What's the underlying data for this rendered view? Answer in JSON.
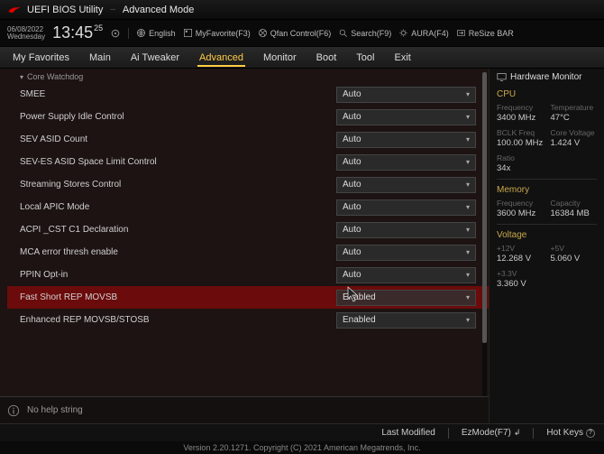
{
  "title_app": "UEFI BIOS Utility",
  "title_mode": "Advanced Mode",
  "date": "06/08/2022",
  "day": "Wednesday",
  "time_main": "13:45",
  "time_sec": "25",
  "toolbar": {
    "lang": "English",
    "fav": "MyFavorite(F3)",
    "qfan": "Qfan Control(F6)",
    "search": "Search(F9)",
    "aura": "AURA(F4)",
    "rebar": "ReSize BAR"
  },
  "menu": [
    "My Favorites",
    "Main",
    "Ai Tweaker",
    "Advanced",
    "Monitor",
    "Boot",
    "Tool",
    "Exit"
  ],
  "menu_active": "Advanced",
  "section": "Core Watchdog",
  "rows": [
    {
      "label": "SMEE",
      "value": "Auto",
      "sel": false
    },
    {
      "label": "Power Supply Idle Control",
      "value": "Auto",
      "sel": false
    },
    {
      "label": "SEV ASID Count",
      "value": "Auto",
      "sel": false
    },
    {
      "label": "SEV-ES ASID Space Limit Control",
      "value": "Auto",
      "sel": false
    },
    {
      "label": "Streaming Stores Control",
      "value": "Auto",
      "sel": false
    },
    {
      "label": "Local APIC Mode",
      "value": "Auto",
      "sel": false
    },
    {
      "label": "ACPI _CST C1 Declaration",
      "value": "Auto",
      "sel": false
    },
    {
      "label": "MCA error thresh enable",
      "value": "Auto",
      "sel": false
    },
    {
      "label": "PPIN Opt-in",
      "value": "Auto",
      "sel": false
    },
    {
      "label": "Fast Short REP MOVSB",
      "value": "Enabled",
      "sel": true
    },
    {
      "label": "Enhanced REP MOVSB/STOSB",
      "value": "Enabled",
      "sel": false
    }
  ],
  "help": "No help string",
  "hw": {
    "title": "Hardware Monitor",
    "cpu": "CPU",
    "cpu_freq_l": "Frequency",
    "cpu_freq_v": "3400 MHz",
    "cpu_temp_l": "Temperature",
    "cpu_temp_v": "47°C",
    "bclk_l": "BCLK Freq",
    "bclk_v": "100.00 MHz",
    "vcore_l": "Core Voltage",
    "vcore_v": "1.424 V",
    "ratio_l": "Ratio",
    "ratio_v": "34x",
    "mem": "Memory",
    "mem_freq_l": "Frequency",
    "mem_freq_v": "3600 MHz",
    "mem_cap_l": "Capacity",
    "mem_cap_v": "16384 MB",
    "volt": "Voltage",
    "v12_l": "+12V",
    "v12_v": "12.268 V",
    "v5_l": "+5V",
    "v5_v": "5.060 V",
    "v33_l": "+3.3V",
    "v33_v": "3.360 V"
  },
  "footer": {
    "last": "Last Modified",
    "ez": "EzMode(F7)",
    "hot": "Hot Keys"
  },
  "version": "Version 2.20.1271. Copyright (C) 2021 American Megatrends, Inc."
}
